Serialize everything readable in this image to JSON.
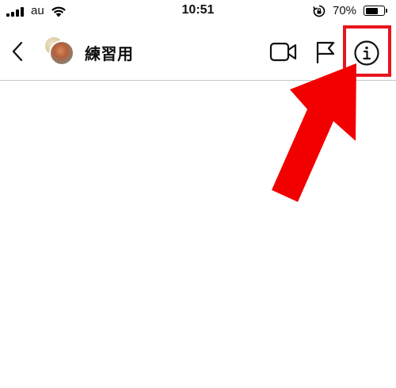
{
  "status_bar": {
    "carrier": "au",
    "time": "10:51",
    "battery_percent_label": "70%",
    "battery_level": 0.7
  },
  "nav": {
    "title": "練習用",
    "icons": {
      "back": "chevron-left-icon",
      "video": "video-call-icon",
      "flag": "flag-icon",
      "info": "info-icon"
    }
  },
  "colors": {
    "highlight": "#e8141e",
    "arrow": "#f20000",
    "divider": "#c8c8c8"
  }
}
